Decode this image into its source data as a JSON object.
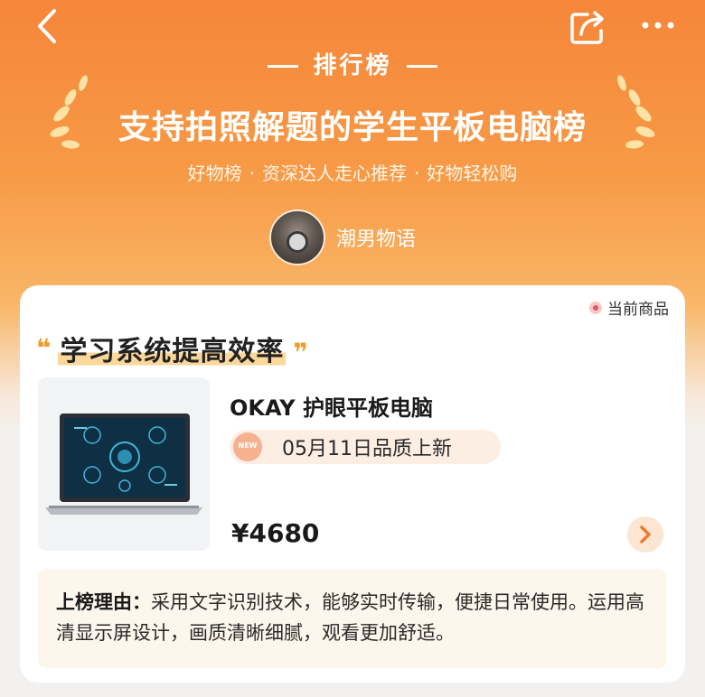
{
  "nav": {
    "back_icon": "chevron-left-icon",
    "share_icon": "share-icon",
    "more_icon": "more-dots-icon"
  },
  "header": {
    "badge_title": "排行榜",
    "list_title": "支持拍照解题的学生平板电脑榜",
    "tagline": [
      "好物榜",
      "资深达人走心推荐",
      "好物轻松购"
    ],
    "author_name": "潮男物语"
  },
  "card": {
    "current_label": "当前商品",
    "section_title": "学习系统提高效率",
    "product_name": "OKAY 护眼平板电脑",
    "quality_text": "05月11日品质上新",
    "price": "¥4680",
    "reason_label": "上榜理由：",
    "reason_text": "采用文字识别技术，能够实时传输，便捷日常使用。运用高清显示屏设计，画质清晰细腻，观看更加舒适。"
  },
  "colors": {
    "accent_orange": "#f5863a",
    "quote_orange": "#f19c2c",
    "highlight": "#fbd79a",
    "current_dot": "#e8506a"
  }
}
